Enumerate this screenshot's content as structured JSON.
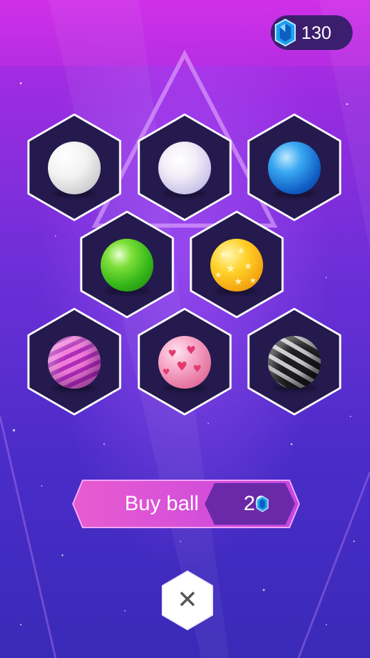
{
  "currency": {
    "amount": "130",
    "icon": "blue-gem-icon"
  },
  "balls": [
    {
      "name": "white-ball",
      "style": "white"
    },
    {
      "name": "pearl-ball",
      "style": "pearl"
    },
    {
      "name": "blue-ball",
      "style": "blue"
    },
    {
      "name": "green-ball",
      "style": "green"
    },
    {
      "name": "star-ball",
      "style": "stars"
    },
    {
      "name": "striped-pink-ball",
      "style": "pink-stripe"
    },
    {
      "name": "heart-ball",
      "style": "hearts"
    },
    {
      "name": "zebra-ball",
      "style": "zebra"
    }
  ],
  "buy": {
    "label": "Buy ball",
    "price": "20",
    "icon": "blue-gem-icon"
  },
  "close": {
    "label": "✕",
    "icon": "close-icon"
  },
  "colors": {
    "accent_pink": "#e85cd0",
    "hex_fill": "#241a4d",
    "panel": "#3b1f6e",
    "gem": "#1fa0f0"
  }
}
